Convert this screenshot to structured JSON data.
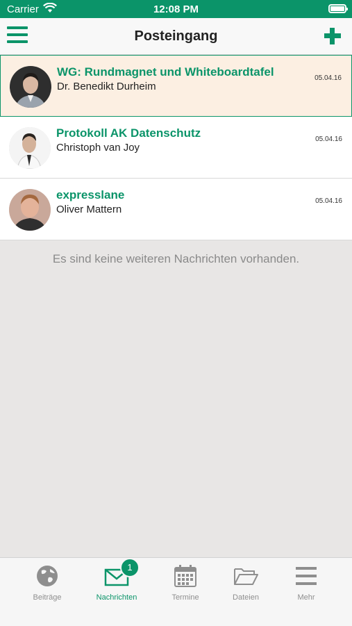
{
  "status_bar": {
    "carrier": "Carrier",
    "time": "12:08 PM"
  },
  "nav": {
    "title": "Posteingang"
  },
  "messages": [
    {
      "subject": "WG: Rundmagnet und Whiteboardtafel",
      "sender": "Dr. Benedikt Durheim",
      "date": "05.04.16",
      "selected": true
    },
    {
      "subject": "Protokoll AK Datenschutz",
      "sender": "Christoph van Joy",
      "date": "05.04.16",
      "selected": false
    },
    {
      "subject": "expresslane",
      "sender": "Oliver Mattern",
      "date": "05.04.16",
      "selected": false
    }
  ],
  "empty_note": "Es sind keine weiteren Nachrichten vorhanden.",
  "tabs": [
    {
      "label": "Beiträge",
      "icon": "globe-icon",
      "active": false
    },
    {
      "label": "Nachrichten",
      "icon": "envelope-icon",
      "active": true,
      "badge": "1"
    },
    {
      "label": "Termine",
      "icon": "calendar-icon",
      "active": false
    },
    {
      "label": "Dateien",
      "icon": "folder-icon",
      "active": false
    },
    {
      "label": "Mehr",
      "icon": "menu-icon",
      "active": false
    }
  ],
  "colors": {
    "accent": "#0b9469",
    "selected_row": "#fcefe2",
    "background": "#e8e6e5"
  }
}
